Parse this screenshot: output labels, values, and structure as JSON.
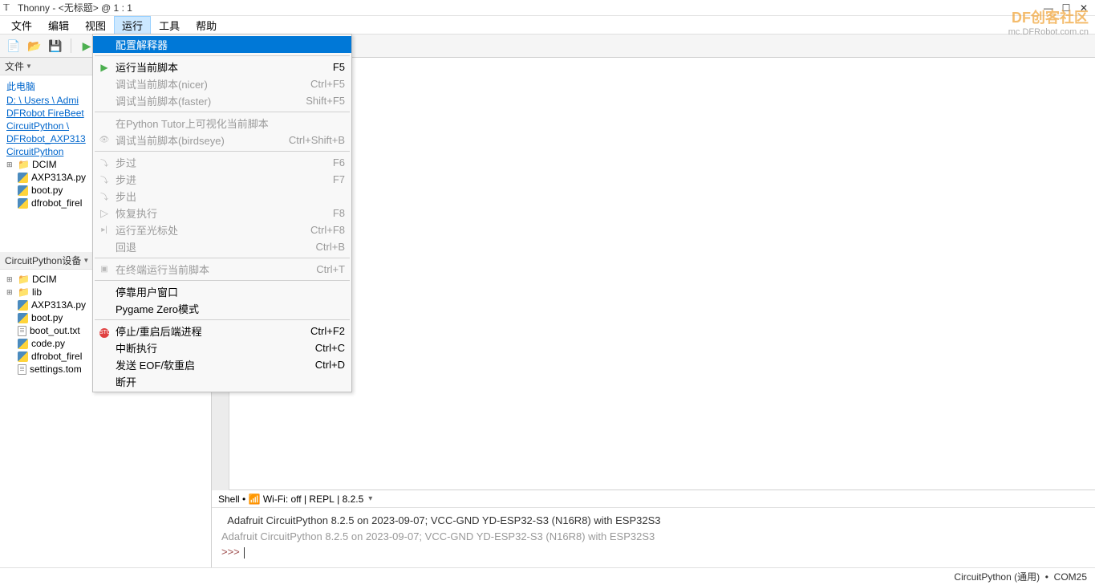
{
  "window": {
    "title": "Thonny  -  <无标题>  @  1 : 1"
  },
  "menu": {
    "items": [
      "文件",
      "编辑",
      "视图",
      "运行",
      "工具",
      "帮助"
    ],
    "active_index": 3
  },
  "watermark": {
    "top": "DF创客社区",
    "bottom": "mc.DFRobot.com.cn"
  },
  "sidebar": {
    "files_title": "文件",
    "this_pc": "此电脑",
    "path_parts": [
      "D: \\ Users \\ Admi",
      "DFRobot FireBeet",
      "CircuitPython \\",
      "DFRobot_AXP313",
      "CircuitPython"
    ],
    "top_tree": [
      {
        "type": "folder",
        "name": "DCIM",
        "expander": "⊞"
      },
      {
        "type": "py",
        "name": "AXP313A.py"
      },
      {
        "type": "py",
        "name": "boot.py"
      },
      {
        "type": "py",
        "name": "dfrobot_firel"
      }
    ],
    "device_title": "CircuitPython设备",
    "bottom_tree": [
      {
        "type": "folder",
        "name": "DCIM",
        "expander": "⊞"
      },
      {
        "type": "folder",
        "name": "lib",
        "expander": "⊞"
      },
      {
        "type": "py",
        "name": "AXP313A.py"
      },
      {
        "type": "py",
        "name": "boot.py"
      },
      {
        "type": "txt",
        "name": "boot_out.txt"
      },
      {
        "type": "py",
        "name": "code.py"
      },
      {
        "type": "py",
        "name": "dfrobot_firel"
      },
      {
        "type": "txt",
        "name": "settings.tom"
      }
    ]
  },
  "run_menu": {
    "groups": [
      [
        {
          "label": "配置解释器",
          "shortcut": "",
          "highlighted": true,
          "icon": ""
        }
      ],
      [
        {
          "label": "运行当前脚本",
          "shortcut": "F5",
          "icon": "run"
        },
        {
          "label": "调试当前脚本(nicer)",
          "shortcut": "Ctrl+F5",
          "disabled": true
        },
        {
          "label": "调试当前脚本(faster)",
          "shortcut": "Shift+F5",
          "disabled": true
        }
      ],
      [
        {
          "label": "在Python Tutor上可视化当前脚本",
          "shortcut": "",
          "disabled": true
        },
        {
          "label": "调试当前脚本(birdseye)",
          "shortcut": "Ctrl+Shift+B",
          "disabled": true,
          "icon": "eye"
        }
      ],
      [
        {
          "label": "步过",
          "shortcut": "F6",
          "disabled": true,
          "icon": "step"
        },
        {
          "label": "步进",
          "shortcut": "F7",
          "disabled": true,
          "icon": "step"
        },
        {
          "label": "步出",
          "shortcut": "",
          "disabled": true,
          "icon": "step"
        },
        {
          "label": "恢复执行",
          "shortcut": "F8",
          "disabled": true,
          "icon": "resume"
        },
        {
          "label": "运行至光标处",
          "shortcut": "Ctrl+F8",
          "disabled": true,
          "icon": "cursor"
        },
        {
          "label": "回退",
          "shortcut": "Ctrl+B",
          "disabled": true
        }
      ],
      [
        {
          "label": "在终端运行当前脚本",
          "shortcut": "Ctrl+T",
          "disabled": true,
          "icon": "terminal"
        }
      ],
      [
        {
          "label": "停靠用户窗口",
          "shortcut": ""
        },
        {
          "label": "Pygame Zero模式",
          "shortcut": ""
        }
      ],
      [
        {
          "label": "停止/重启后端进程",
          "shortcut": "Ctrl+F2",
          "icon": "stop"
        },
        {
          "label": "中断执行",
          "shortcut": "Ctrl+C"
        },
        {
          "label": "发送 EOF/软重启",
          "shortcut": "Ctrl+D"
        },
        {
          "label": "断开",
          "shortcut": ""
        }
      ]
    ]
  },
  "shell": {
    "header": "Shell",
    "wifi": "Wi-Fi: off",
    "repl": "REPL",
    "version": "8.2.5",
    "line1": "Adafruit CircuitPython 8.2.5 on 2023-09-07; VCC-GND YD-ESP32-S3 (N16R8) with ESP32S3",
    "line2": "Adafruit CircuitPython 8.2.5 on 2023-09-07; VCC-GND YD-ESP32-S3 (N16R8) with ESP32S3",
    "prompt": ">>> "
  },
  "status": {
    "interpreter": "CircuitPython (通用)",
    "port": "COM25"
  }
}
